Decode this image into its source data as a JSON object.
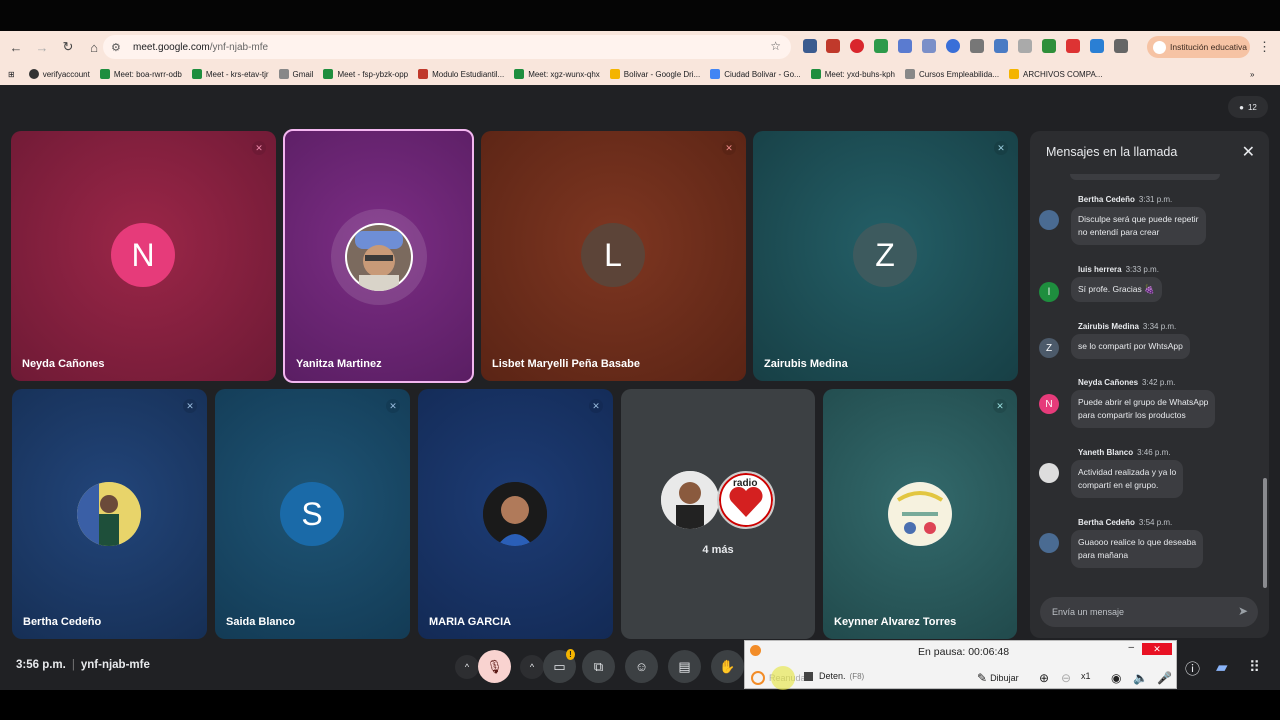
{
  "browser": {
    "url_host": "meet.google.com",
    "url_path": "/ynf-njab-mfe",
    "profile_label": "Institución educativa",
    "bookmarks": [
      "verifyaccount",
      "Meet: boa-rwrr-odb",
      "Meet - krs-etav-tjr",
      "Gmail",
      "Meet - fsp-ybzk-opp",
      "Modulo Estudiantil...",
      "Meet: xgz-wunx-qhx",
      "Bolivar - Google Dri...",
      "Ciudad Bolivar - Go...",
      "Meet: yxd-buhs-kph",
      "Cursos Empleabilida...",
      "ARCHIVOS COMPA..."
    ]
  },
  "meet": {
    "participant_count": "12",
    "time": "3:56 p.m.",
    "meeting_code": "ynf-njab-mfe",
    "tiles_row1": [
      {
        "name": "Neyda Cañones",
        "initial": "N"
      },
      {
        "name": "Yanitza Martinez",
        "initial": ""
      },
      {
        "name": "Lisbet Maryelli Peña Basabe",
        "initial": "L"
      },
      {
        "name": "Zairubis Medina",
        "initial": "Z"
      }
    ],
    "tiles_row2": [
      {
        "name": "Bertha Cedeño",
        "initial": ""
      },
      {
        "name": "Saida Blanco",
        "initial": "S"
      },
      {
        "name": "MARIA GARCIA",
        "initial": ""
      },
      {
        "name": "",
        "initial": ""
      },
      {
        "name": "Keynner Alvarez Torres",
        "initial": ""
      }
    ],
    "more_label": "4 más",
    "radio_badge": "radio"
  },
  "chat": {
    "title": "Mensajes en la llamada",
    "input_placeholder": "Envía un mensaje",
    "messages": [
      {
        "author": "Bertha Cedeño",
        "time": "3:31 p.m.",
        "text": [
          "Disculpe será que puede repetir",
          "no entendí  para crear"
        ],
        "avatar": ""
      },
      {
        "author": "luis herrera",
        "time": "3:33 p.m.",
        "text": [
          "Sí profe. Gracias 🍇"
        ],
        "avatar": "l"
      },
      {
        "author": "Zairubis Medina",
        "time": "3:34 p.m.",
        "text": [
          "se lo compartí por WhtsApp"
        ],
        "avatar": "Z"
      },
      {
        "author": "Neyda Cañones",
        "time": "3:42 p.m.",
        "text": [
          "Puede abrir el grupo de WhatsApp",
          "para compartir los productos"
        ],
        "avatar": "N"
      },
      {
        "author": "Yaneth Blanco",
        "time": "3:46 p.m.",
        "text": [
          "Actividad realizada y ya lo",
          "compartí en el grupo."
        ],
        "avatar": ""
      },
      {
        "author": "Bertha Cedeño",
        "time": "3:54 p.m.",
        "text": [
          "Guaooo realice lo que deseaba",
          "para mañana"
        ],
        "avatar": ""
      }
    ]
  },
  "recorder": {
    "status": "En pausa: 00:06:48",
    "resume_label": "Reanudar",
    "stop_label": "Deten.",
    "stop_key": "(F8)",
    "draw_label": "Dibujar",
    "zoom_label": "x1"
  },
  "colors": {
    "neyda": "#8a1f40",
    "yanitza": "#6d2474",
    "lisbet": "#70301f",
    "zairubis": "#1f5058",
    "bertha": "#1b3966",
    "saida": "#1c4b6b",
    "maria": "#1a3366",
    "grey": "#3c4043",
    "keynner": "#2c5a5d"
  }
}
